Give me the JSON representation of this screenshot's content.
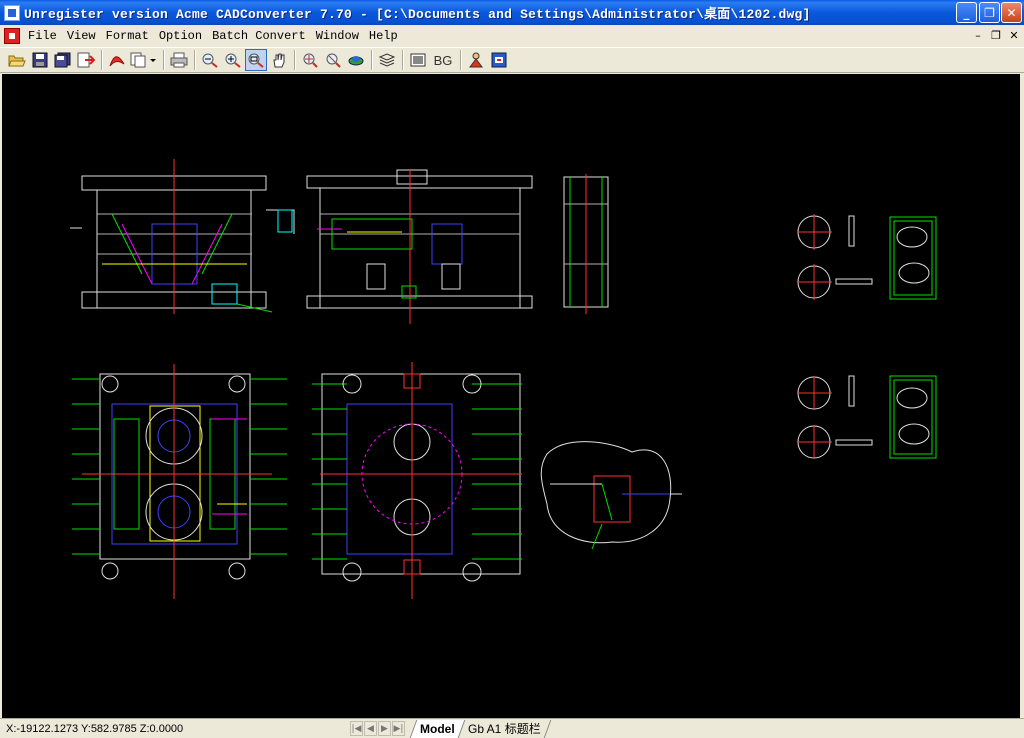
{
  "window": {
    "title": "Unregister version Acme CADConverter 7.70 - [C:\\Documents and Settings\\Administrator\\桌面\\1202.dwg]",
    "minimize": "_",
    "maximize": "❐",
    "close": "✕"
  },
  "menu": {
    "items": [
      "File",
      "View",
      "Format",
      "Option",
      "Batch Convert",
      "Window",
      "Help"
    ]
  },
  "mdi": {
    "minimize": "–",
    "restore": "❐",
    "close": "✕"
  },
  "toolbar": {
    "buttons": [
      {
        "name": "open-icon"
      },
      {
        "name": "save-icon"
      },
      {
        "name": "save-all-icon"
      },
      {
        "name": "export-icon"
      },
      {
        "name": "convert-pdf-icon"
      },
      {
        "name": "copy-icon"
      },
      {
        "name": "print-icon"
      },
      {
        "name": "zoom-out-icon"
      },
      {
        "name": "zoom-in-icon"
      },
      {
        "name": "zoom-window-icon"
      },
      {
        "name": "pan-icon"
      },
      {
        "name": "zoom-all-icon"
      },
      {
        "name": "zoom-extents-icon"
      },
      {
        "name": "layer-icon"
      },
      {
        "name": "layers-list-icon"
      },
      {
        "name": "properties-icon"
      }
    ],
    "bg_label": "BG",
    "colors": {
      "accent": "#316ac5"
    }
  },
  "statusbar": {
    "coords": "X:-19122.1273 Y:582.9785 Z:0.0000",
    "nav": [
      "|◀",
      "◀",
      "▶",
      "▶|"
    ],
    "tabs": [
      {
        "label": "Model",
        "active": true
      },
      {
        "label": "Gb A1 标题栏",
        "active": false
      }
    ]
  }
}
